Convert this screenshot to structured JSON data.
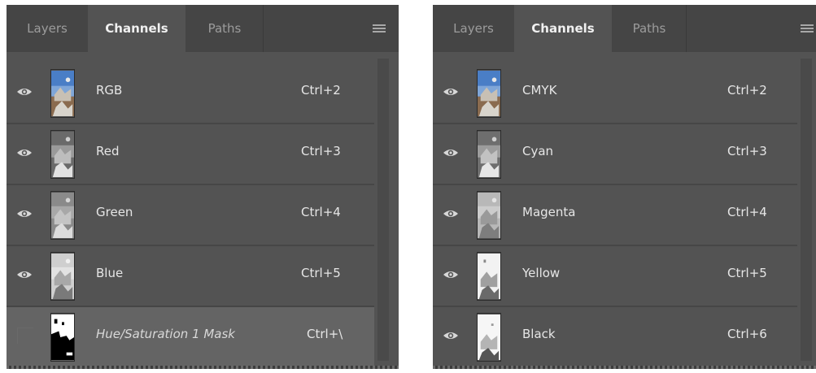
{
  "left_panel": {
    "tabs": [
      {
        "label": "Layers"
      },
      {
        "label": "Channels",
        "active": true
      },
      {
        "label": "Paths"
      }
    ],
    "menu_icon": "panel-menu-icon",
    "channels": [
      {
        "name": "RGB",
        "shortcut": "Ctrl+2",
        "visible": true,
        "thumb": "rgb-composite"
      },
      {
        "name": "Red",
        "shortcut": "Ctrl+3",
        "visible": true,
        "thumb": "grayscale"
      },
      {
        "name": "Green",
        "shortcut": "Ctrl+4",
        "visible": true,
        "thumb": "grayscale"
      },
      {
        "name": "Blue",
        "shortcut": "Ctrl+5",
        "visible": true,
        "thumb": "grayscale-light"
      },
      {
        "name": "Hue/Saturation 1 Mask",
        "shortcut": "Ctrl+\\",
        "visible": false,
        "selected": true,
        "italic": true,
        "thumb": "mask"
      }
    ]
  },
  "right_panel": {
    "tabs": [
      {
        "label": "Layers"
      },
      {
        "label": "Channels",
        "active": true
      },
      {
        "label": "Paths"
      }
    ],
    "menu_icon": "panel-menu-icon",
    "channels": [
      {
        "name": "CMYK",
        "shortcut": "Ctrl+2",
        "visible": true,
        "thumb": "rgb-composite"
      },
      {
        "name": "Cyan",
        "shortcut": "Ctrl+3",
        "visible": true,
        "thumb": "grayscale"
      },
      {
        "name": "Magenta",
        "shortcut": "Ctrl+4",
        "visible": true,
        "thumb": "grayscale"
      },
      {
        "name": "Yellow",
        "shortcut": "Ctrl+5",
        "visible": true,
        "thumb": "grayscale-light"
      },
      {
        "name": "Black",
        "shortcut": "Ctrl+6",
        "visible": true,
        "thumb": "grayscale-light"
      }
    ]
  },
  "colors": {
    "panel_bg": "#535353",
    "tabbar_bg": "#454545",
    "row_divider": "#464646",
    "selected_row": "#646464",
    "text": "#e6e6e6"
  }
}
